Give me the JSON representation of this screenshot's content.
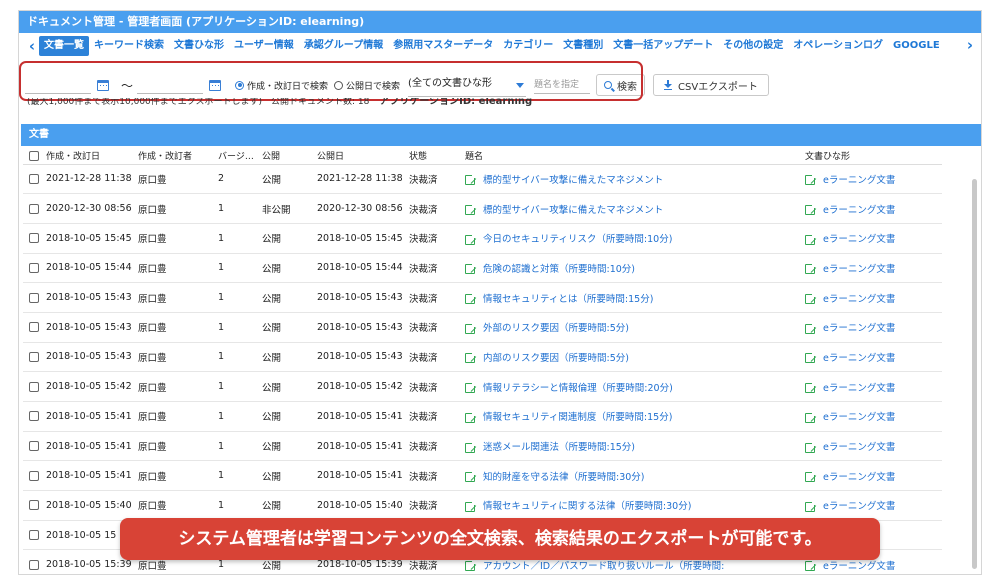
{
  "window": {
    "title": "ドキュメント管理 - 管理者画面 (アプリケーションID: elearning)"
  },
  "tabs": [
    {
      "label": "文書一覧",
      "active": true
    },
    {
      "label": "キーワード検索"
    },
    {
      "label": "文書ひな形"
    },
    {
      "label": "ユーザー情報"
    },
    {
      "label": "承認グループ情報"
    },
    {
      "label": "参照用マスターデータ"
    },
    {
      "label": "カテゴリー"
    },
    {
      "label": "文書種別"
    },
    {
      "label": "文書一括アップデート"
    },
    {
      "label": "その他の設定"
    },
    {
      "label": "オペレーションログ"
    },
    {
      "label": "GOOGLE"
    }
  ],
  "toolbar": {
    "date_from": "",
    "date_to": "",
    "tilde": "～",
    "radio_created": "作成・改訂日で検索",
    "radio_published": "公開日で検索",
    "template_select": "(全ての文書ひな形",
    "title_placeholder": "題名を指定",
    "search_label": "検索",
    "csv_label": "CSVエクスポート"
  },
  "note": {
    "limit": "(最大1,000件まで表示10,000件までエクスポートします)　公開ドキュメント数: 18",
    "app_id": "アプリケーションID: elearning"
  },
  "section_title": "文書",
  "columns": [
    "作成・改訂日",
    "作成・改訂者",
    "バージ…",
    "公開",
    "公開日",
    "状態",
    "題名",
    "文書ひな形"
  ],
  "rows": [
    [
      "2021-12-28 11:38",
      "原口豊",
      "2",
      "公開",
      "2021-12-28 11:38",
      "決裁済",
      "標的型サイバー攻撃に備えたマネジメント",
      "eラーニング文書"
    ],
    [
      "2020-12-30 08:56",
      "原口豊",
      "1",
      "非公開",
      "2020-12-30 08:56",
      "決裁済",
      "標的型サイバー攻撃に備えたマネジメント",
      "eラーニング文書"
    ],
    [
      "2018-10-05 15:45",
      "原口豊",
      "1",
      "公開",
      "2018-10-05 15:45",
      "決裁済",
      "今日のセキュリティリスク（所要時間:10分)",
      "eラーニング文書"
    ],
    [
      "2018-10-05 15:44",
      "原口豊",
      "1",
      "公開",
      "2018-10-05 15:44",
      "決裁済",
      "危険の認識と対策（所要時間:10分)",
      "eラーニング文書"
    ],
    [
      "2018-10-05 15:43",
      "原口豊",
      "1",
      "公開",
      "2018-10-05 15:43",
      "決裁済",
      "情報セキュリティとは（所要時間:15分)",
      "eラーニング文書"
    ],
    [
      "2018-10-05 15:43",
      "原口豊",
      "1",
      "公開",
      "2018-10-05 15:43",
      "決裁済",
      "外部のリスク要因（所要時間:5分)",
      "eラーニング文書"
    ],
    [
      "2018-10-05 15:43",
      "原口豊",
      "1",
      "公開",
      "2018-10-05 15:43",
      "決裁済",
      "内部のリスク要因（所要時間:5分)",
      "eラーニング文書"
    ],
    [
      "2018-10-05 15:42",
      "原口豊",
      "1",
      "公開",
      "2018-10-05 15:42",
      "決裁済",
      "情報リテラシーと情報倫理（所要時間:20分)",
      "eラーニング文書"
    ],
    [
      "2018-10-05 15:41",
      "原口豊",
      "1",
      "公開",
      "2018-10-05 15:41",
      "決裁済",
      "情報セキュリティ関連制度（所要時間:15分)",
      "eラーニング文書"
    ],
    [
      "2018-10-05 15:41",
      "原口豊",
      "1",
      "公開",
      "2018-10-05 15:41",
      "決裁済",
      "迷惑メール関連法（所要時間:15分)",
      "eラーニング文書"
    ],
    [
      "2018-10-05 15:41",
      "原口豊",
      "1",
      "公開",
      "2018-10-05 15:41",
      "決裁済",
      "知的財産を守る法律（所要時間:30分)",
      "eラーニング文書"
    ],
    [
      "2018-10-05 15:40",
      "原口豊",
      "1",
      "公開",
      "2018-10-05 15:40",
      "決裁済",
      "情報セキュリティに関する法律（所要時間:30分)",
      "eラーニング文書"
    ],
    [
      "2018-10-05 15",
      "",
      "",
      "",
      "",
      "",
      "",
      ""
    ],
    [
      "2018-10-05 15:39",
      "原口豊",
      "1",
      "公開",
      "2018-10-05 15:39",
      "決裁済",
      "アカウント／ID／パスワード取り扱いルール（所要時間:",
      "eラーニング文書"
    ]
  ],
  "banner": "システム管理者は学習コンテンツの全文検索、検索結果のエクスポートが可能です。",
  "colors": {
    "header": "#4a9fef",
    "link": "#1e6fd0",
    "highlight": "#c62f2f",
    "banner": "#d84336",
    "icon_green": "#32a852"
  }
}
